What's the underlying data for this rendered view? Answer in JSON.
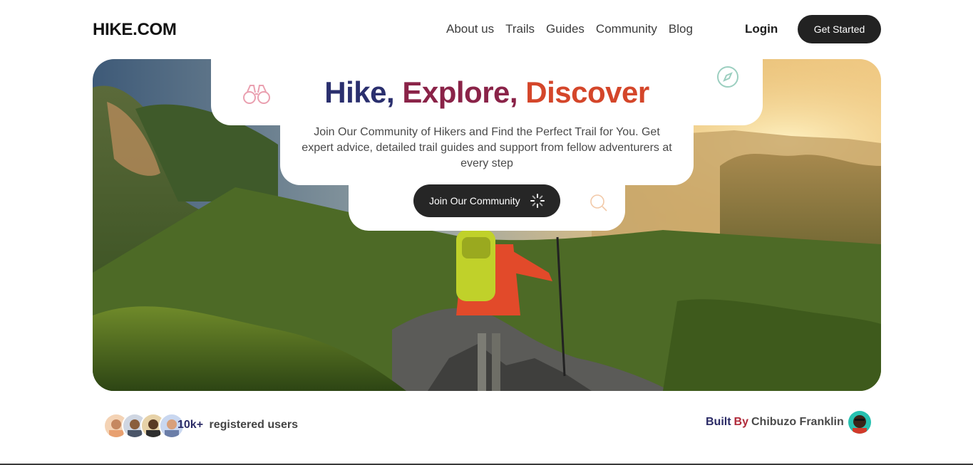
{
  "nav": {
    "logo": "HIKE.COM",
    "links": [
      "About us",
      "Trails",
      "Guides",
      "Community",
      "Blog"
    ],
    "login": "Login",
    "get_started": "Get Started"
  },
  "hero": {
    "headline": {
      "part1": "Hike,",
      "part2": "Explore,",
      "part3": "Discover"
    },
    "subtitle": "Join Our Community of Hikers and Find the Perfect Trail for You. Get expert advice, detailed trail guides and support from fellow adventurers at every step",
    "cta": "Join Our Community",
    "icons": [
      "binoculars-icon",
      "compass-icon",
      "search-icon",
      "loading-spinner-icon"
    ],
    "colors": {
      "hike": "#2a2f6e",
      "explore": "#8a2348",
      "discover": "#d4462a"
    }
  },
  "users": {
    "count": "10k+",
    "label": "registered users"
  },
  "credit": {
    "built": "Built",
    "by": "By",
    "name": "Chibuzo Franklin"
  }
}
